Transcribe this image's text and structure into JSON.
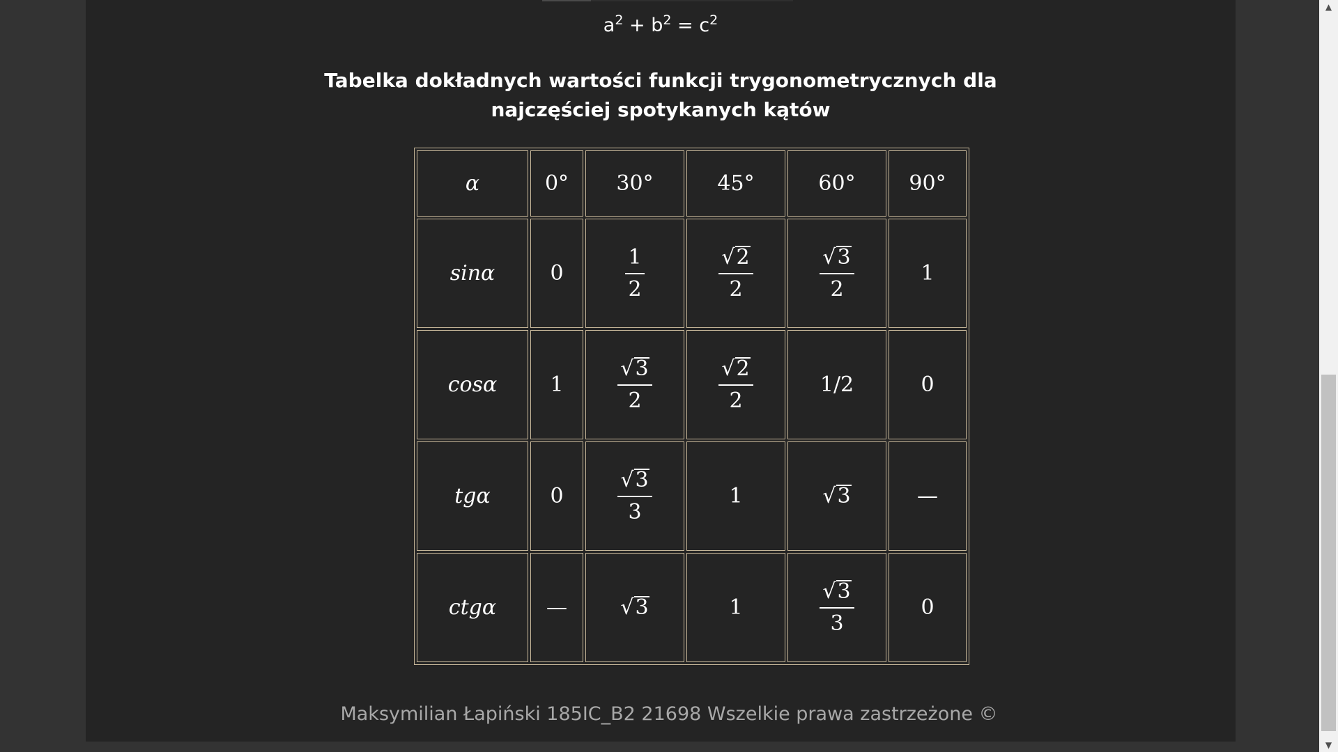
{
  "formula": {
    "a": "a",
    "b": "b",
    "c": "c",
    "exp": "2",
    "plus": "+",
    "eq": "="
  },
  "heading": {
    "line1": "Tabelka dokładnych wartości funkcji trygonometrycznych dla",
    "line2": "najczęściej spotykanych kątów"
  },
  "table": {
    "header": [
      "α",
      "0°",
      "30°",
      "45°",
      "60°",
      "90°"
    ],
    "sin": {
      "label": "sinα",
      "v0": "0",
      "v30_num": "1",
      "v30_den": "2",
      "v45_rad": "2",
      "v45_den": "2",
      "v60_rad": "3",
      "v60_den": "2",
      "v90": "1"
    },
    "cos": {
      "label": "cosα",
      "v0": "1",
      "v30_rad": "3",
      "v30_den": "2",
      "v45_rad": "2",
      "v45_den": "2",
      "v60": "1/2",
      "v90": "0"
    },
    "tg": {
      "label": "tgα",
      "v0": "0",
      "v30_rad": "3",
      "v30_den": "3",
      "v45": "1",
      "v60_rad": "3",
      "v90": "—"
    },
    "ctg": {
      "label": "ctgα",
      "v0": "—",
      "v30_rad": "3",
      "v45": "1",
      "v60_rad": "3",
      "v60_den": "3",
      "v90": "0"
    },
    "sqrt_symbol": "√",
    "border_color": "#c8b89a"
  },
  "footer": {
    "text": "Maksymilian Łapiński 185IC_B2 21698 Wszelkie prawa zastrzeżone ©"
  },
  "scrollbar": {
    "up_arrow": "▲",
    "down_arrow": "▼"
  },
  "colors": {
    "page_bg": "#242424",
    "outer_bg": "#333333",
    "text": "#ffffff",
    "footer_text": "#a8a8a8"
  }
}
